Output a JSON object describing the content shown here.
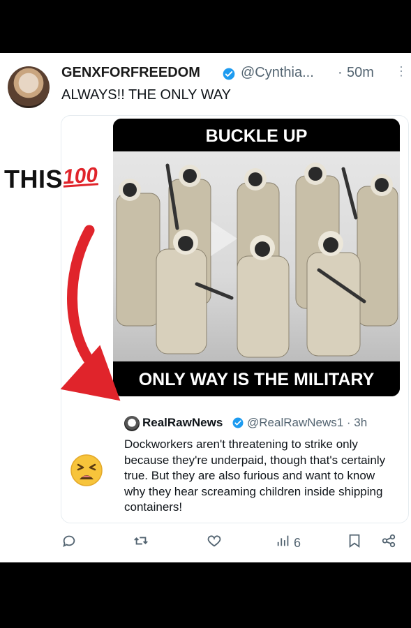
{
  "post": {
    "author_name": "GENXFORFREEDOM",
    "handle": "@Cynthia...",
    "dot": "·",
    "time": "50m",
    "more": "⋮",
    "text": "ALWAYS!! THE ONLY WAY"
  },
  "annotation": {
    "label": "THIS",
    "emoji_text": "100"
  },
  "meme": {
    "top_text": "BUCKLE UP",
    "bottom_text": "ONLY WAY IS THE MILITARY"
  },
  "quote": {
    "author_name": "RealRawNews",
    "handle_time": "@RealRawNews1 · 3h",
    "text": "Dockworkers aren't threatening to strike only because they're underpaid, though that's certainly true. But they are also furious and want to know why they hear screaming children inside shipping containers!"
  },
  "actions": {
    "views": "6"
  },
  "colors": {
    "accent_red": "#e0242b",
    "verified_blue": "#1d9bf0",
    "text_gray": "#536471"
  },
  "icons": [
    "verified-badge-icon",
    "more-icon",
    "reply-icon",
    "retweet-icon",
    "like-icon",
    "views-icon",
    "bookmark-icon",
    "share-icon",
    "play-icon",
    "arrow-icon",
    "tired-face-emoji-icon"
  ]
}
